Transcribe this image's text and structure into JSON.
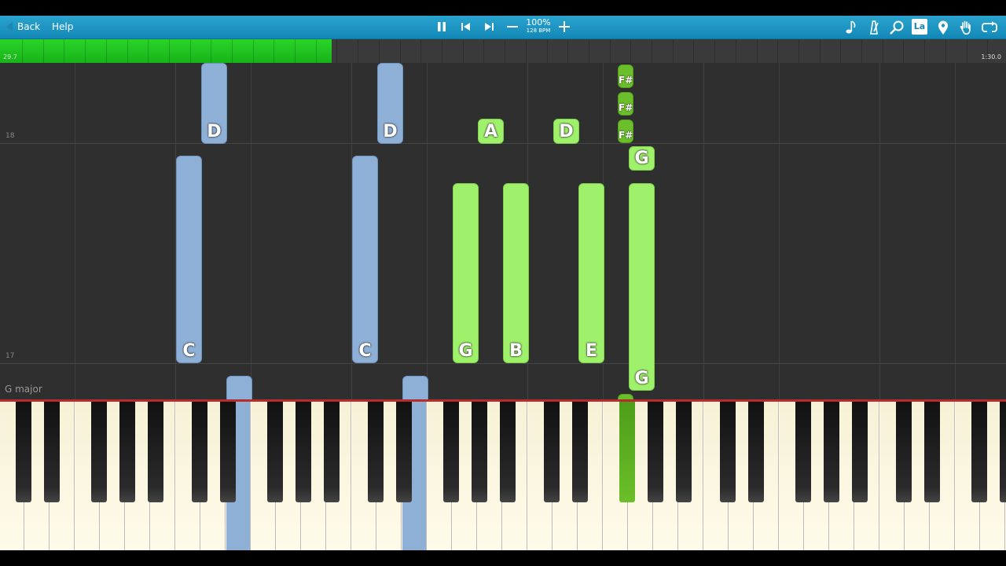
{
  "toolbar": {
    "back_label": "Back",
    "help_label": "Help",
    "speed_percent": "100%",
    "speed_bpm": "128 BPM",
    "icons": [
      "pause-icon",
      "previous-icon",
      "next-icon",
      "minus-icon",
      "plus-icon",
      "note-icon",
      "metronome-icon",
      "search-icon",
      "label-icon",
      "location-pin-icon",
      "hand-icon",
      "loop-icon"
    ],
    "label_button_text": "La"
  },
  "progress": {
    "fraction": 0.33,
    "current_time": "29.7",
    "total_time": "1:30.0"
  },
  "roll": {
    "measure_labels": [
      "18",
      "17"
    ],
    "key_signature": "G major"
  },
  "notes": [
    {
      "label": "D",
      "hand": "left"
    },
    {
      "label": "C",
      "hand": "left"
    },
    {
      "label": "D",
      "hand": "left"
    },
    {
      "label": "C",
      "hand": "left"
    },
    {
      "label": "G",
      "hand": "right"
    },
    {
      "label": "B",
      "hand": "right"
    },
    {
      "label": "E",
      "hand": "right"
    },
    {
      "label": "A",
      "hand": "right"
    },
    {
      "label": "D",
      "hand": "right"
    },
    {
      "label": "F#",
      "hand": "right"
    },
    {
      "label": "F#",
      "hand": "right"
    },
    {
      "label": "F#",
      "hand": "right"
    },
    {
      "label": "G",
      "hand": "right"
    },
    {
      "label": "G",
      "hand": "right"
    }
  ],
  "colors": {
    "left_hand": "#8fb0d6",
    "right_hand": "#9ff06a",
    "right_hand_active": "#6bbf2a",
    "toolbar": "#1a96c4",
    "progress_fill": "#22c422"
  }
}
